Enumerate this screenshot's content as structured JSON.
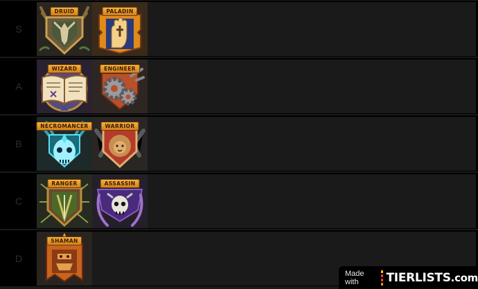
{
  "tiers": [
    {
      "label": "S",
      "items": [
        {
          "name": "DRUID"
        },
        {
          "name": "PALADIN"
        }
      ]
    },
    {
      "label": "A",
      "items": [
        {
          "name": "WIZARD"
        },
        {
          "name": "ENGINEER"
        }
      ]
    },
    {
      "label": "B",
      "items": [
        {
          "name": "NECROMANCER"
        },
        {
          "name": "WARRIOR"
        }
      ]
    },
    {
      "label": "C",
      "items": [
        {
          "name": "RANGER"
        },
        {
          "name": "ASSASSIN"
        }
      ]
    },
    {
      "label": "D",
      "items": [
        {
          "name": "SHAMAN"
        }
      ]
    }
  ],
  "watermark": {
    "made_with": "Made with",
    "brand": "TIERLISTS",
    "brand_suffix": ".com"
  },
  "colors": {
    "page_bg": "#1a1a1a",
    "tier_label_text": "#2e2e2e",
    "badge_gold": "#f4b33a",
    "logo_bars": [
      "#f5c400",
      "#e53935",
      "#e53935",
      "#fb8c00"
    ]
  },
  "icons": {
    "DRUID": "antler-shield-icon",
    "PALADIN": "holy-hand-icon",
    "WIZARD": "spellbook-icon",
    "ENGINEER": "gears-icon",
    "NECROMANCER": "glowing-skull-icon",
    "WARRIOR": "lion-shield-icon",
    "RANGER": "arrows-shield-icon",
    "ASSASSIN": "skull-daggers-icon",
    "SHAMAN": "totem-banner-icon"
  }
}
